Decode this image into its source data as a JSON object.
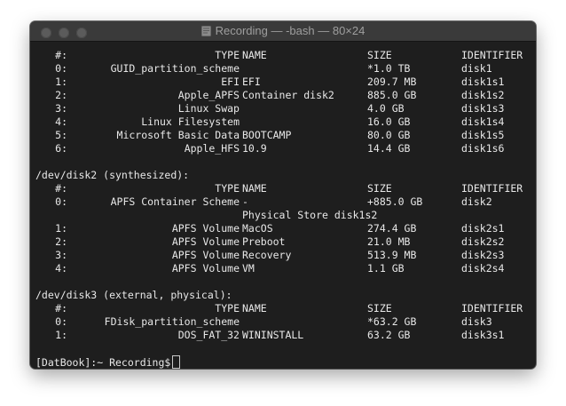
{
  "window": {
    "title": "Recording — -bash — 80×24"
  },
  "disks": [
    {
      "header": "",
      "columns": {
        "num": "#:",
        "type": "TYPE",
        "name": "NAME",
        "size": "SIZE",
        "id": "IDENTIFIER"
      },
      "rows": [
        {
          "num": "0:",
          "type": "GUID_partition_scheme",
          "name": "",
          "size": "*1.0 TB",
          "id": "disk1"
        },
        {
          "num": "1:",
          "type": "EFI",
          "name": "EFI",
          "size": "209.7 MB",
          "id": "disk1s1"
        },
        {
          "num": "2:",
          "type": "Apple_APFS",
          "name": "Container disk2",
          "size": "885.0 GB",
          "id": "disk1s2"
        },
        {
          "num": "3:",
          "type": "Linux Swap",
          "name": "",
          "size": "4.0 GB",
          "id": "disk1s3"
        },
        {
          "num": "4:",
          "type": "Linux Filesystem",
          "name": "",
          "size": "16.0 GB",
          "id": "disk1s4"
        },
        {
          "num": "5:",
          "type": "Microsoft Basic Data",
          "name": "BOOTCAMP",
          "size": "80.0 GB",
          "id": "disk1s5"
        },
        {
          "num": "6:",
          "type": "Apple_HFS",
          "name": "10.9",
          "size": "14.4 GB",
          "id": "disk1s6"
        }
      ]
    },
    {
      "header": "/dev/disk2 (synthesized):",
      "columns": {
        "num": "#:",
        "type": "TYPE",
        "name": "NAME",
        "size": "SIZE",
        "id": "IDENTIFIER"
      },
      "rows": [
        {
          "num": "0:",
          "type": "APFS Container Scheme",
          "name": "-",
          "size": "+885.0 GB",
          "id": "disk2"
        },
        {
          "num": "",
          "type": "",
          "name": "Physical Store disk1s2",
          "size": "",
          "id": ""
        },
        {
          "num": "1:",
          "type": "APFS Volume",
          "name": "MacOS",
          "size": "274.4 GB",
          "id": "disk2s1"
        },
        {
          "num": "2:",
          "type": "APFS Volume",
          "name": "Preboot",
          "size": "21.0 MB",
          "id": "disk2s2"
        },
        {
          "num": "3:",
          "type": "APFS Volume",
          "name": "Recovery",
          "size": "513.9 MB",
          "id": "disk2s3"
        },
        {
          "num": "4:",
          "type": "APFS Volume",
          "name": "VM",
          "size": "1.1 GB",
          "id": "disk2s4"
        }
      ]
    },
    {
      "header": "/dev/disk3 (external, physical):",
      "columns": {
        "num": "#:",
        "type": "TYPE",
        "name": "NAME",
        "size": "SIZE",
        "id": "IDENTIFIER"
      },
      "rows": [
        {
          "num": "0:",
          "type": "FDisk_partition_scheme",
          "name": "",
          "size": "*63.2 GB",
          "id": "disk3"
        },
        {
          "num": "1:",
          "type": "DOS_FAT_32",
          "name": "WININSTALL",
          "size": "63.2 GB",
          "id": "disk3s1"
        }
      ]
    }
  ],
  "prompt": {
    "text": "[DatBook]:~ Recording$"
  },
  "colors": {
    "terminal_bg": "#1e1e1e",
    "terminal_fg": "#e8e8e8",
    "titlebar_bg": "#3a3a3a"
  }
}
